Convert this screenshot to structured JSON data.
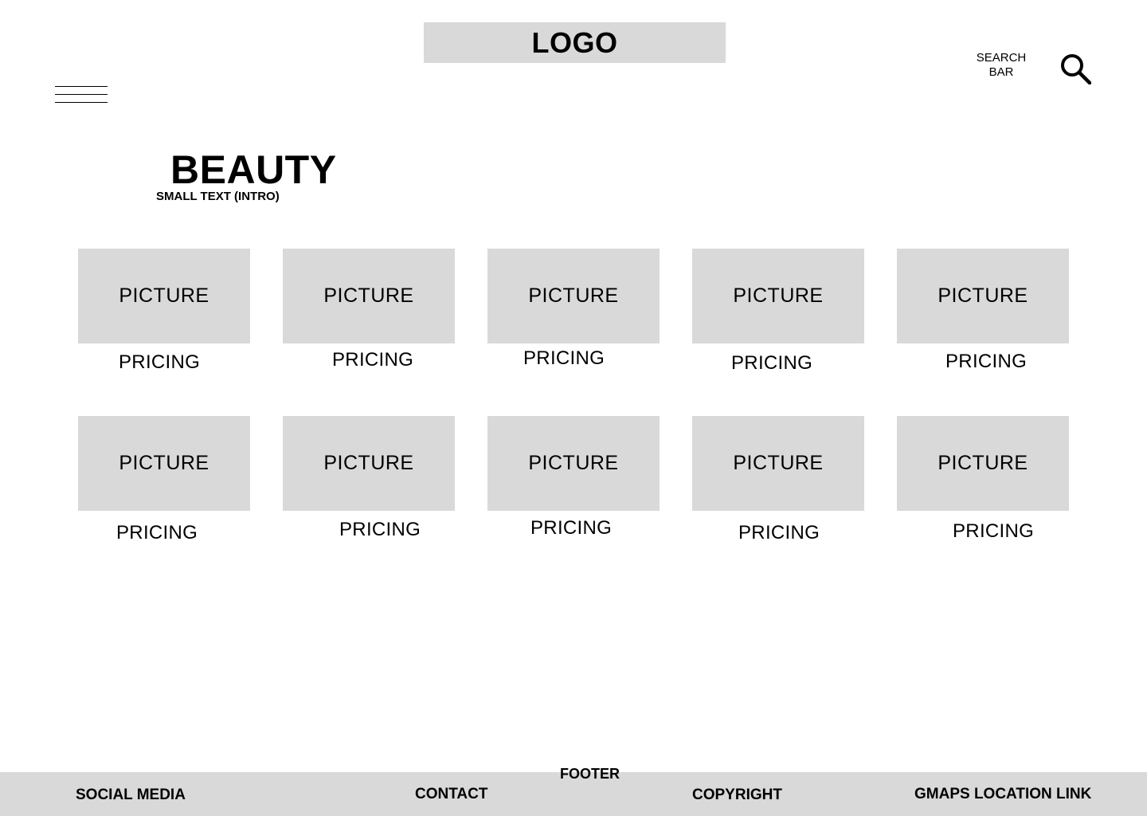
{
  "header": {
    "logo": "LOGO",
    "search_label_line1": "SEARCH",
    "search_label_line2": "BAR"
  },
  "hero": {
    "title": "BEAUTY",
    "intro": "SMALL TEXT (INTRO)"
  },
  "products": {
    "row1": [
      {
        "picture": "PICTURE",
        "pricing": "PRICING"
      },
      {
        "picture": "PICTURE",
        "pricing": "PRICING"
      },
      {
        "picture": "PICTURE",
        "pricing": "PRICING"
      },
      {
        "picture": "PICTURE",
        "pricing": "PRICING"
      },
      {
        "picture": "PICTURE",
        "pricing": "PRICING"
      }
    ],
    "row2": [
      {
        "picture": "PICTURE",
        "pricing": "PRICING"
      },
      {
        "picture": "PICTURE",
        "pricing": "PRICING"
      },
      {
        "picture": "PICTURE",
        "pricing": "PRICING"
      },
      {
        "picture": "PICTURE",
        "pricing": "PRICING"
      },
      {
        "picture": "PICTURE",
        "pricing": "PRICING"
      }
    ]
  },
  "footer": {
    "label": "FOOTER",
    "social": "SOCIAL MEDIA",
    "contact": "CONTACT",
    "copyright": "COPYRIGHT",
    "gmaps": "GMAPS LOCATION LINK"
  },
  "colors": {
    "placeholder_fill": "#d9d9d9",
    "text": "#000000",
    "background": "#ffffff"
  },
  "icons": [
    "menu-icon",
    "search-icon"
  ]
}
